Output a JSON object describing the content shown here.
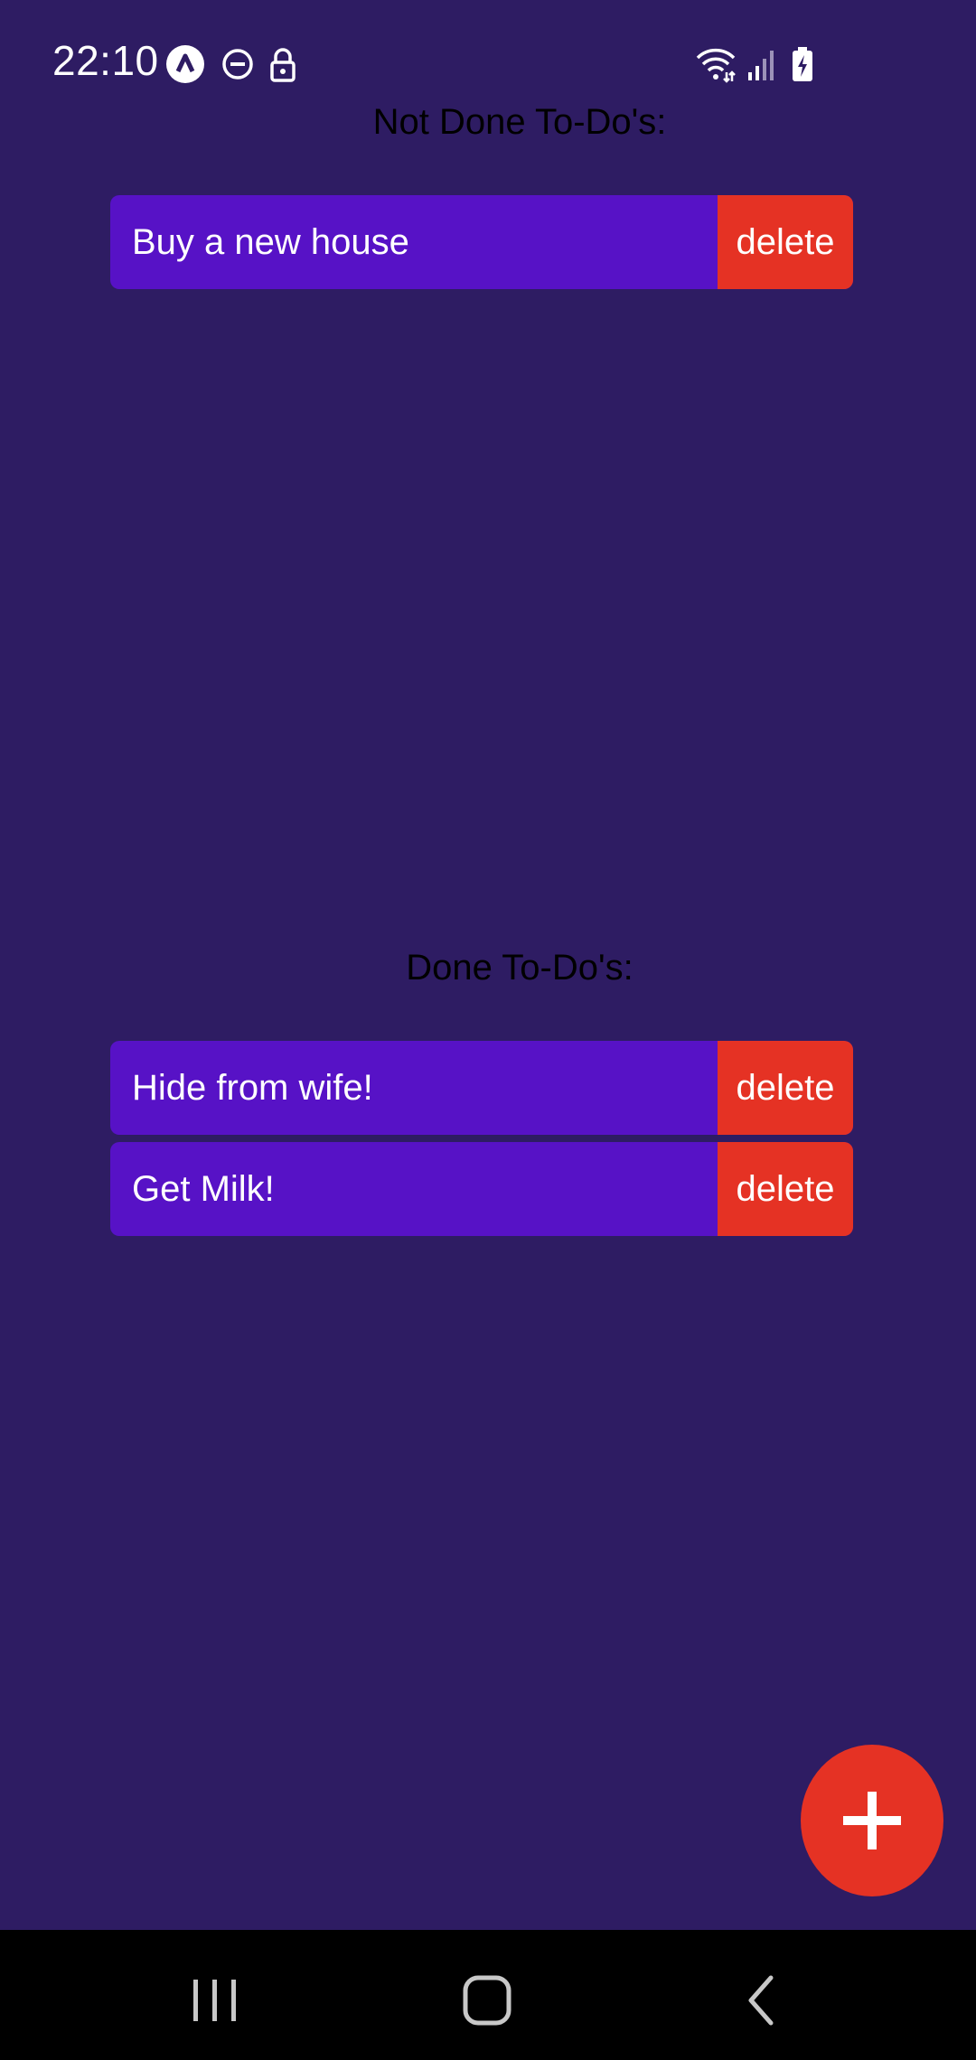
{
  "status_bar": {
    "time": "22:10",
    "icons": [
      "app-notification-icon",
      "do-not-disturb-icon",
      "lock-icon",
      "wifi-icon",
      "signal-icon",
      "battery-charging-icon"
    ]
  },
  "sections": {
    "not_done": {
      "heading": "Not Done To-Do's:",
      "items": [
        {
          "text": "Buy a new house",
          "delete_label": "delete"
        }
      ]
    },
    "done": {
      "heading": "Done To-Do's:",
      "items": [
        {
          "text": "Hide from wife!",
          "delete_label": "delete"
        },
        {
          "text": "Get Milk!",
          "delete_label": "delete"
        }
      ]
    }
  },
  "fab": {
    "icon": "plus-icon"
  },
  "nav_bar": {
    "icons": [
      "recent-apps-icon",
      "home-icon",
      "back-icon"
    ]
  },
  "colors": {
    "background": "#2e1c63",
    "todo_item": "#5712c6",
    "delete": "#e53224",
    "fab": "#e53224",
    "heading_text": "#000000",
    "item_text": "#ffffff"
  }
}
